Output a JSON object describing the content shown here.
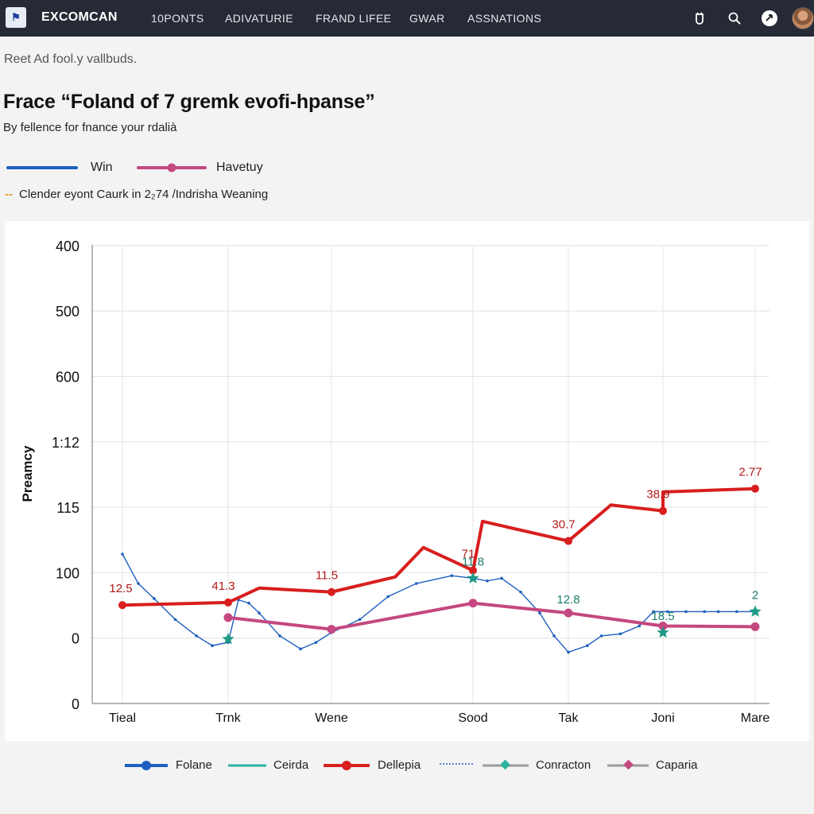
{
  "header": {
    "brand": "EXCOMCAN",
    "nav": [
      "10PONTS",
      "ADIVATURIE",
      "FRAND LIFEE",
      "GWAR",
      "ASSNATIONS"
    ],
    "icons": [
      "bell-icon",
      "search-icon",
      "theme-icon",
      "avatar"
    ]
  },
  "breadcrumb": "Reet Ad fool.y vallbuds.",
  "title": "Frace “Foland of 7 gremk evofi-hpanse”",
  "subtitle": "By fellence for fnance your rdalià",
  "top_legend": [
    {
      "label": "Win",
      "color": "#1f5fbf"
    },
    {
      "label": "Havetuy",
      "color": "#c4487f"
    }
  ],
  "note": {
    "marker": "--",
    "text": "Clender eyont Caurk in 2₂74 /Indrisha Weaning"
  },
  "chart_data": {
    "type": "line",
    "title": "",
    "xlabel": "",
    "ylabel": "Preamcy",
    "categories": [
      "Tieal",
      "Trnk",
      "Wene",
      "Sood",
      "Tak",
      "Joni",
      "Mare"
    ],
    "y_tick_labels": [
      "0",
      "0",
      "100",
      "115",
      "1:12",
      "600",
      "500",
      "400"
    ],
    "grid": true,
    "series": [
      {
        "name": "Dellepia",
        "color": "#d81e1e",
        "x": [
          "Tieal",
          "Trnk",
          "Wene",
          "Sood",
          "Tak",
          "Joni",
          "Mare"
        ],
        "y": [
          0.52,
          0.56,
          0.72,
          1.05,
          1.5,
          1.96,
          2.3
        ],
        "data_labels": [
          "12.5",
          "41.3",
          "11.5",
          "71",
          "30.7",
          "38.9",
          "2.77"
        ]
      },
      {
        "name": "Caparia",
        "color": "#c4487f",
        "x": [
          "Trnk",
          "Wene",
          "Sood",
          "Tak",
          "Joni",
          "Mare"
        ],
        "y": [
          0.33,
          0.15,
          0.55,
          0.4,
          0.2,
          0.19
        ]
      },
      {
        "name": "Folane",
        "color": "#1f5fbf",
        "x": [
          0.0,
          0.15,
          0.3,
          0.5,
          0.7,
          0.85,
          1.0,
          1.1,
          1.2,
          1.3,
          1.5,
          1.7,
          1.85,
          2.0,
          2.2,
          2.4,
          2.6,
          2.85,
          3.0,
          3.15,
          3.3,
          3.5,
          3.7,
          3.85,
          4.0,
          4.2,
          4.35,
          4.55,
          4.75,
          4.9,
          5.05,
          5.25,
          5.45,
          5.6,
          5.8,
          6.0
        ],
        "y": [
          1.3,
          0.85,
          0.62,
          0.3,
          0.05,
          -0.1,
          -0.05,
          0.6,
          0.55,
          0.4,
          0.05,
          -0.15,
          -0.05,
          0.1,
          0.3,
          0.65,
          0.85,
          0.97,
          0.93,
          0.89,
          0.93,
          0.72,
          0.4,
          0.05,
          -0.2,
          -0.1,
          0.05,
          0.08,
          0.2,
          0.42,
          0.42,
          0.42,
          0.42,
          0.42,
          0.42,
          0.42
        ]
      },
      {
        "name": "Conracton",
        "color": "#1c9a86",
        "x": [
          "Trnk",
          "Sood",
          "Joni",
          "Mare"
        ],
        "y": [
          0.0,
          0.93,
          0.1,
          0.42
        ],
        "data_labels": [
          "",
          "11.8",
          "18.5",
          "2"
        ]
      }
    ],
    "extra_labels": [
      {
        "x": "Tak",
        "y": 0.62,
        "text": "12.8",
        "color": "#1c7d6f"
      }
    ],
    "legend": [
      "Folane",
      "Ceirda",
      "Dellepia",
      "Conracton",
      "Caparia"
    ],
    "legend_position": "bottom"
  },
  "bottom_legend": [
    {
      "label": "Folane",
      "color": "#1f5fbf",
      "style": "solid-circle"
    },
    {
      "label": "Ceirda",
      "color": "#2cb3a0",
      "style": "solid"
    },
    {
      "label": "Dellepia",
      "color": "#d81e1e",
      "style": "solid-circle"
    },
    {
      "label": "",
      "color": "#1f5fbf",
      "style": "dotted"
    },
    {
      "label": "Conracton",
      "color": "#2cb3a0",
      "style": "gray-diamond"
    },
    {
      "label": "Caparia",
      "color": "#c4487f",
      "style": "gray-diamond"
    }
  ]
}
